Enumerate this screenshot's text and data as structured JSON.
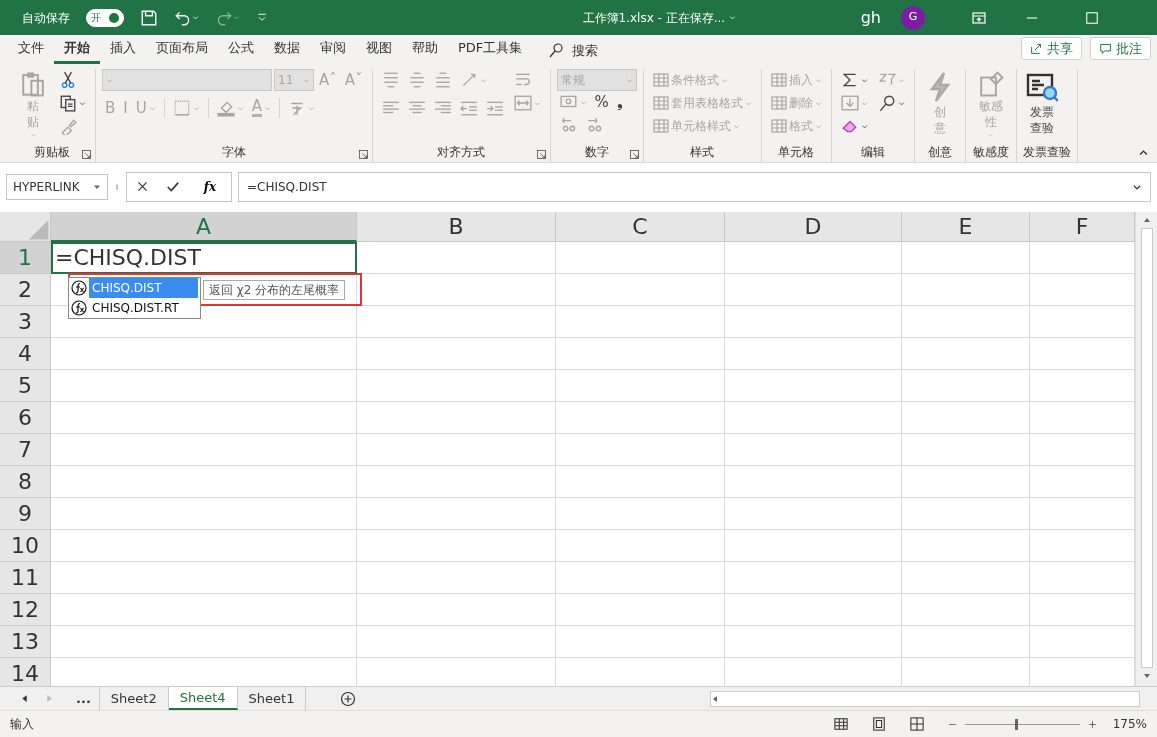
{
  "title_bar": {
    "autosave": {
      "label": "自动保存",
      "toggle_label": "开",
      "on": true
    },
    "title": "工作簿1.xlsx - 正在保存...",
    "user": "gh",
    "avatar": "G"
  },
  "menu": {
    "tabs": [
      {
        "label": "文件",
        "selected": false
      },
      {
        "label": "开始",
        "selected": true
      },
      {
        "label": "插入",
        "selected": false
      },
      {
        "label": "页面布局",
        "selected": false
      },
      {
        "label": "公式",
        "selected": false
      },
      {
        "label": "数据",
        "selected": false
      },
      {
        "label": "审阅",
        "selected": false
      },
      {
        "label": "视图",
        "selected": false
      },
      {
        "label": "帮助",
        "selected": false
      },
      {
        "label": "PDF工具集",
        "selected": false
      }
    ],
    "search": "搜索",
    "share": "共享",
    "comments": "批注"
  },
  "ribbon": [
    {
      "label": "剪贴板",
      "launcher": true,
      "blocks": [
        {
          "kind": "stack",
          "items": [
            {
              "kind": "large",
              "label": "粘贴",
              "disabled": true,
              "caret": true
            }
          ]
        },
        {
          "kind": "stack",
          "items": [
            {
              "kind": "icon",
              "disabled": false,
              "caret": false
            },
            {
              "kind": "icon",
              "disabled": false,
              "caret": true
            },
            {
              "kind": "icon",
              "disabled": true,
              "caret": false
            }
          ]
        }
      ]
    },
    {
      "label": "字体",
      "launcher": true,
      "blocks": [
        {
          "kind": "rows",
          "rows": [
            [
              {
                "kind": "select",
                "disabled": true
              },
              {
                "kind": "select",
                "value": "11",
                "disabled": true
              },
              {
                "kind": "text",
                "label": "Aˆ",
                "disabled": true,
                "caret": false
              },
              {
                "kind": "text",
                "label": "Aˇ",
                "disabled": true,
                "caret": false
              }
            ],
            [
              {
                "kind": "text",
                "label": "B",
                "disabled": true,
                "caret": false
              },
              {
                "kind": "text",
                "label": "I",
                "disabled": true,
                "caret": false
              },
              {
                "kind": "text",
                "label": "U",
                "disabled": true,
                "caret": true
              },
              {
                "kind": "separator"
              },
              {
                "kind": "icon",
                "disabled": true,
                "caret": true
              },
              {
                "kind": "separator"
              },
              {
                "kind": "icon",
                "disabled": true,
                "caret": true
              },
              {
                "kind": "color",
                "label": "A",
                "disabled": true,
                "caret": true
              },
              {
                "kind": "separator"
              },
              {
                "kind": "icon",
                "disabled": true,
                "caret": true
              }
            ]
          ]
        }
      ]
    },
    {
      "label": "对齐方式",
      "launcher": true,
      "blocks": [
        {
          "kind": "rows",
          "rows": [
            [
              {
                "kind": "icon",
                "disabled": true,
                "caret": false
              },
              {
                "kind": "icon",
                "disabled": true,
                "caret": false
              },
              {
                "kind": "icon",
                "disabled": true,
                "caret": false
              },
              {
                "kind": "icon",
                "disabled": true,
                "caret": true
              }
            ],
            [
              {
                "kind": "icon",
                "disabled": true,
                "caret": false
              },
              {
                "kind": "icon",
                "disabled": true,
                "caret": false
              },
              {
                "kind": "icon",
                "disabled": true,
                "caret": false
              },
              {
                "kind": "icon",
                "disabled": true,
                "caret": false
              },
              {
                "kind": "icon",
                "disabled": true,
                "caret": false
              }
            ]
          ]
        },
        {
          "kind": "stack",
          "items": [
            {
              "kind": "icon",
              "disabled": true,
              "caret": false
            },
            {
              "kind": "icon",
              "disabled": true,
              "caret": true
            }
          ]
        }
      ]
    },
    {
      "label": "数字",
      "launcher": true,
      "blocks": [
        {
          "kind": "rows",
          "rows": [
            [
              {
                "kind": "select",
                "value": "常规",
                "disabled": true
              }
            ],
            [
              {
                "kind": "icon",
                "disabled": true,
                "caret": true
              },
              {
                "kind": "text",
                "label": "%",
                "disabled": false,
                "caret": false
              },
              {
                "kind": "text",
                "label": "❟",
                "disabled": false,
                "caret": false
              }
            ],
            [
              {
                "kind": "icon",
                "disabled": true,
                "caret": false
              },
              {
                "kind": "icon",
                "disabled": true,
                "caret": false
              }
            ]
          ]
        }
      ]
    },
    {
      "label": "样式",
      "launcher": false,
      "blocks": [
        {
          "kind": "stack",
          "items": [
            {
              "kind": "small",
              "label": "条件格式",
              "disabled": true,
              "caret": true
            },
            {
              "kind": "small",
              "label": "套用表格格式",
              "disabled": true,
              "caret": true
            },
            {
              "kind": "small",
              "label": "单元格样式",
              "disabled": true,
              "caret": true
            }
          ]
        }
      ]
    },
    {
      "label": "单元格",
      "launcher": false,
      "blocks": [
        {
          "kind": "stack",
          "items": [
            {
              "kind": "small",
              "label": "插入",
              "disabled": true,
              "caret": true
            },
            {
              "kind": "small",
              "label": "删除",
              "disabled": true,
              "caret": true
            },
            {
              "kind": "small",
              "label": "格式",
              "disabled": true,
              "caret": true
            }
          ]
        }
      ]
    },
    {
      "label": "编辑",
      "launcher": false,
      "blocks": [
        {
          "kind": "stack",
          "items": [
            {
              "kind": "icon",
              "disabled": false,
              "caret": true
            },
            {
              "kind": "icon",
              "disabled": true,
              "caret": true
            },
            {
              "kind": "icon",
              "disabled": false,
              "caret": true
            }
          ]
        },
        {
          "kind": "stack",
          "items": [
            {
              "kind": "icon",
              "disabled": true,
              "caret": true
            },
            {
              "kind": "icon",
              "disabled": false,
              "caret": true
            }
          ]
        }
      ]
    },
    {
      "label": "创意",
      "launcher": false,
      "blocks": [
        {
          "kind": "stack",
          "items": [
            {
              "kind": "large",
              "label": "创意",
              "disabled": true,
              "caret": false
            }
          ]
        }
      ]
    },
    {
      "label": "敏感度",
      "launcher": false,
      "blocks": [
        {
          "kind": "stack",
          "items": [
            {
              "kind": "large",
              "label": "敏感性",
              "disabled": true,
              "caret": true
            }
          ]
        }
      ]
    },
    {
      "label": "发票查验",
      "launcher": false,
      "blocks": [
        {
          "kind": "stack",
          "items": [
            {
              "kind": "large",
              "label": "发票查验",
              "disabled": false,
              "caret": false
            }
          ]
        }
      ]
    }
  ],
  "formula_bar": {
    "name_box": "HYPERLINK",
    "fx": "fx",
    "formula": "=CHISQ.DIST"
  },
  "sheet": {
    "columns": [
      {
        "label": "A",
        "selected": true
      },
      {
        "label": "B",
        "selected": false
      },
      {
        "label": "C",
        "selected": false
      },
      {
        "label": "D",
        "selected": false
      },
      {
        "label": "E",
        "selected": false
      },
      {
        "label": "F",
        "selected": false
      }
    ],
    "rows": [
      {
        "label": "1",
        "selected": true
      },
      {
        "label": "2",
        "selected": false
      },
      {
        "label": "3",
        "selected": false
      },
      {
        "label": "4",
        "selected": false
      },
      {
        "label": "5",
        "selected": false
      },
      {
        "label": "6",
        "selected": false
      },
      {
        "label": "7",
        "selected": false
      },
      {
        "label": "8",
        "selected": false
      },
      {
        "label": "9",
        "selected": false
      },
      {
        "label": "10",
        "selected": false
      },
      {
        "label": "11",
        "selected": false
      },
      {
        "label": "12",
        "selected": false
      },
      {
        "label": "13",
        "selected": false
      },
      {
        "label": "14",
        "selected": false
      }
    ],
    "active_cell": "=CHISQ.DIST",
    "autocomplete": {
      "items": [
        {
          "label": "CHISQ.DIST",
          "selected": true
        },
        {
          "label": "CHISQ.DIST.RT",
          "selected": false
        }
      ],
      "tooltip": "返回 χ2 分布的左尾概率",
      "highlighted": true
    }
  },
  "sheet_tabs": {
    "more": "...",
    "tabs": [
      {
        "label": "Sheet2",
        "selected": false
      },
      {
        "label": "Sheet4",
        "selected": true
      },
      {
        "label": "Sheet1",
        "selected": false
      }
    ]
  },
  "status_bar": {
    "mode": "输入",
    "zoom": {
      "level": 0.45,
      "reading": "175%"
    }
  }
}
